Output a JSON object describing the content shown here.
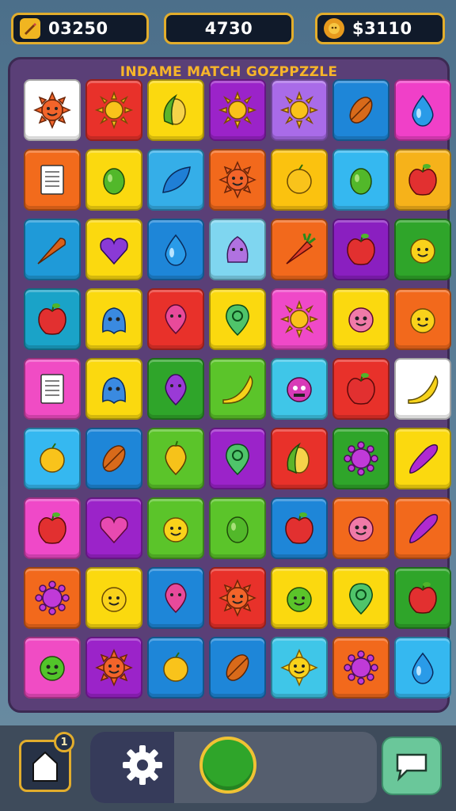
{
  "hud": {
    "left_value": "03250",
    "middle_value": "4730",
    "right_value": "$3110",
    "left_icon": "pencil-icon",
    "right_icon": "coin-icon"
  },
  "board": {
    "title": "INDAME MATCH GOZPPZZLE",
    "rows": [
      [
        {
          "bg": "#ffffff",
          "icon": "sun-face"
        },
        {
          "bg": "#e8312a",
          "icon": "sun"
        },
        {
          "bg": "#fbd90f",
          "icon": "corn"
        },
        {
          "bg": "#9b23c9",
          "icon": "sun"
        },
        {
          "bg": "#a96be8",
          "icon": "sun"
        },
        {
          "bg": "#1e86d8",
          "icon": "leaf-orange"
        },
        {
          "bg": "#f040c8",
          "icon": "drop"
        }
      ],
      [
        {
          "bg": "#f26b1c",
          "icon": "note"
        },
        {
          "bg": "#fbd90f",
          "icon": "lemon-green"
        },
        {
          "bg": "#35aee8",
          "icon": "leaf-blue"
        },
        {
          "bg": "#f2691c",
          "icon": "sun-face"
        },
        {
          "bg": "#fbc20f",
          "icon": "lemon"
        },
        {
          "bg": "#35b8f0",
          "icon": "lemon-green"
        },
        {
          "bg": "#f6b21a",
          "icon": "apple"
        }
      ],
      [
        {
          "bg": "#1f9ad8",
          "icon": "carrot"
        },
        {
          "bg": "#fbd90f",
          "icon": "heart-purple"
        },
        {
          "bg": "#1e86d8",
          "icon": "drop"
        },
        {
          "bg": "#7fd6f0",
          "icon": "blob-purple"
        },
        {
          "bg": "#f2691c",
          "icon": "carrot-green"
        },
        {
          "bg": "#8a1fc0",
          "icon": "apple"
        },
        {
          "bg": "#2fa52a",
          "icon": "lemon-face"
        }
      ],
      [
        {
          "bg": "#1aa3c8",
          "icon": "apple"
        },
        {
          "bg": "#fbd90f",
          "icon": "blob-blue"
        },
        {
          "bg": "#e8312a",
          "icon": "drop-pink"
        },
        {
          "bg": "#fbd90f",
          "icon": "pin-green"
        },
        {
          "bg": "#ef49c8",
          "icon": "sun"
        },
        {
          "bg": "#fbd90f",
          "icon": "blob-pink"
        },
        {
          "bg": "#f2691c",
          "icon": "lemon-face"
        }
      ],
      [
        {
          "bg": "#f04cc4",
          "icon": "note"
        },
        {
          "bg": "#fbd90f",
          "icon": "blob-blue"
        },
        {
          "bg": "#2fa52a",
          "icon": "drop-purple"
        },
        {
          "bg": "#5bc42a",
          "icon": "banana"
        },
        {
          "bg": "#3fc6e8",
          "icon": "monster-pink"
        },
        {
          "bg": "#e8312a",
          "icon": "apple"
        },
        {
          "bg": "#ffffff",
          "icon": "banana"
        }
      ],
      [
        {
          "bg": "#35b8f0",
          "icon": "lemon"
        },
        {
          "bg": "#1e86d8",
          "icon": "leaf-orange"
        },
        {
          "bg": "#5bc42a",
          "icon": "drop-yellow"
        },
        {
          "bg": "#9b23c9",
          "icon": "pin-green"
        },
        {
          "bg": "#e8312a",
          "icon": "corn"
        },
        {
          "bg": "#2fa52a",
          "icon": "sun-purple"
        },
        {
          "bg": "#fbd90f",
          "icon": "eggplant"
        }
      ],
      [
        {
          "bg": "#ef49c8",
          "icon": "apple"
        },
        {
          "bg": "#9b23c9",
          "icon": "heart-pink"
        },
        {
          "bg": "#5bc42a",
          "icon": "lemon-face"
        },
        {
          "bg": "#5bc42a",
          "icon": "lemon-green"
        },
        {
          "bg": "#1e86d8",
          "icon": "apple"
        },
        {
          "bg": "#f2691c",
          "icon": "blob-pink"
        },
        {
          "bg": "#f2691c",
          "icon": "eggplant"
        }
      ],
      [
        {
          "bg": "#f2691c",
          "icon": "sun-purple"
        },
        {
          "bg": "#fbd90f",
          "icon": "lemon-face"
        },
        {
          "bg": "#1e86d8",
          "icon": "drop-pink"
        },
        {
          "bg": "#e8312a",
          "icon": "sun-face"
        },
        {
          "bg": "#fbd90f",
          "icon": "lemon-face-green"
        },
        {
          "bg": "#fbd90f",
          "icon": "pin-green"
        },
        {
          "bg": "#2fa52a",
          "icon": "apple"
        }
      ],
      [
        {
          "bg": "#f04cc4",
          "icon": "monster-green"
        },
        {
          "bg": "#9b23c9",
          "icon": "sun-face"
        },
        {
          "bg": "#1e86d8",
          "icon": "lemon"
        },
        {
          "bg": "#1e86d8",
          "icon": "leaf-orange"
        },
        {
          "bg": "#3fc6e8",
          "icon": "sun-face-yellow"
        },
        {
          "bg": "#f2691c",
          "icon": "sun-purple"
        },
        {
          "bg": "#35b8f0",
          "icon": "drop"
        }
      ]
    ]
  },
  "bottom": {
    "badge": "1",
    "home_icon": "home-icon",
    "settings_icon": "gear-icon",
    "play_icon": "play-circle-icon",
    "chat_icon": "chat-icon"
  }
}
